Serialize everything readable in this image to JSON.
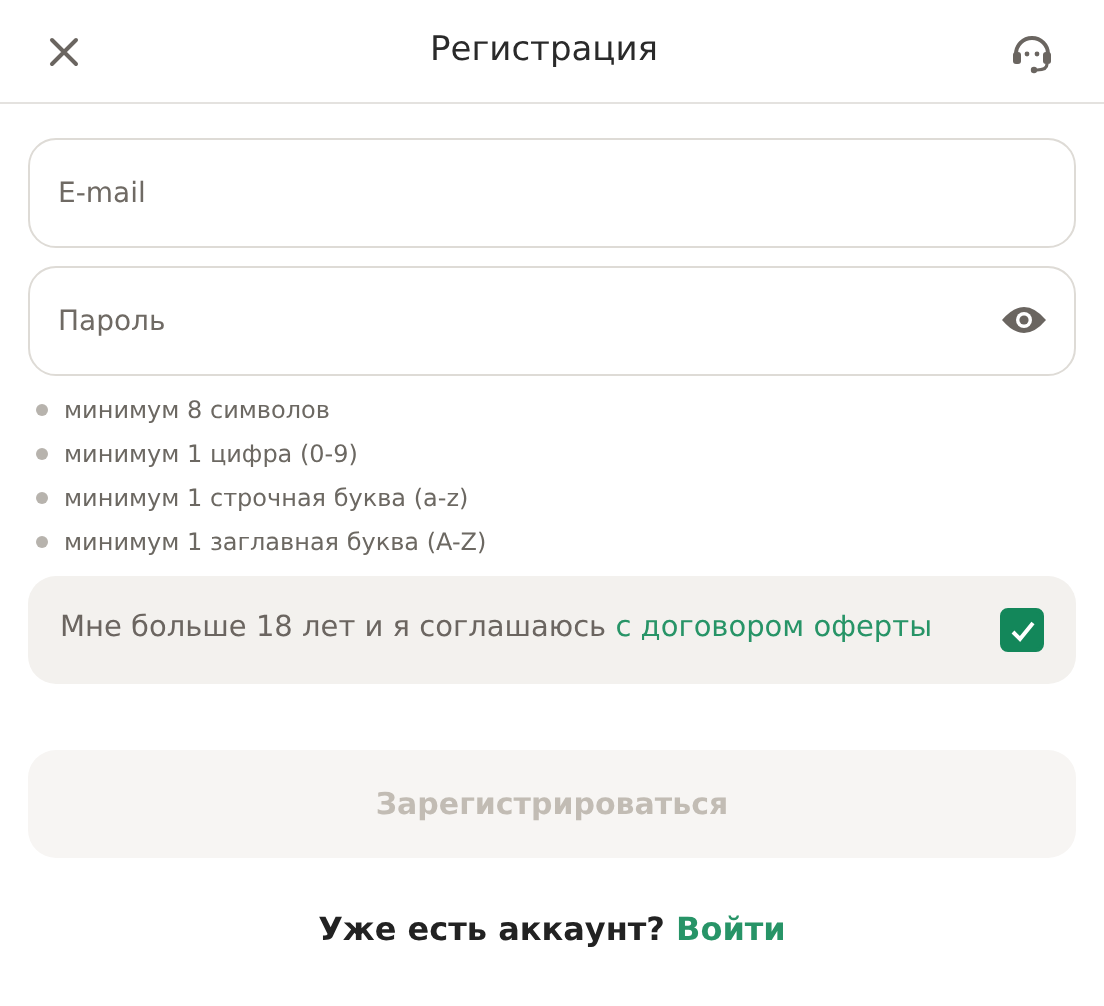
{
  "header": {
    "title": "Регистрация"
  },
  "fields": [
    {
      "kind": "text",
      "placeholder": "E-mail"
    },
    {
      "kind": "password",
      "placeholder": "Пароль"
    }
  ],
  "password_rules": [
    "минимум 8 символов",
    "минимум 1 цифра (0-9)",
    "минимум 1 строчная буква (a-z)",
    "минимум 1 заглавная буква (A-Z)"
  ],
  "agreement": {
    "text": "Мне больше 18 лет и я соглашаюсь",
    "link": "с договором оферты",
    "checked": true
  },
  "submit": {
    "label": "Зарегистрироваться",
    "disabled": true
  },
  "footer": {
    "text": "Уже есть аккаунт?",
    "link": "Войти"
  }
}
